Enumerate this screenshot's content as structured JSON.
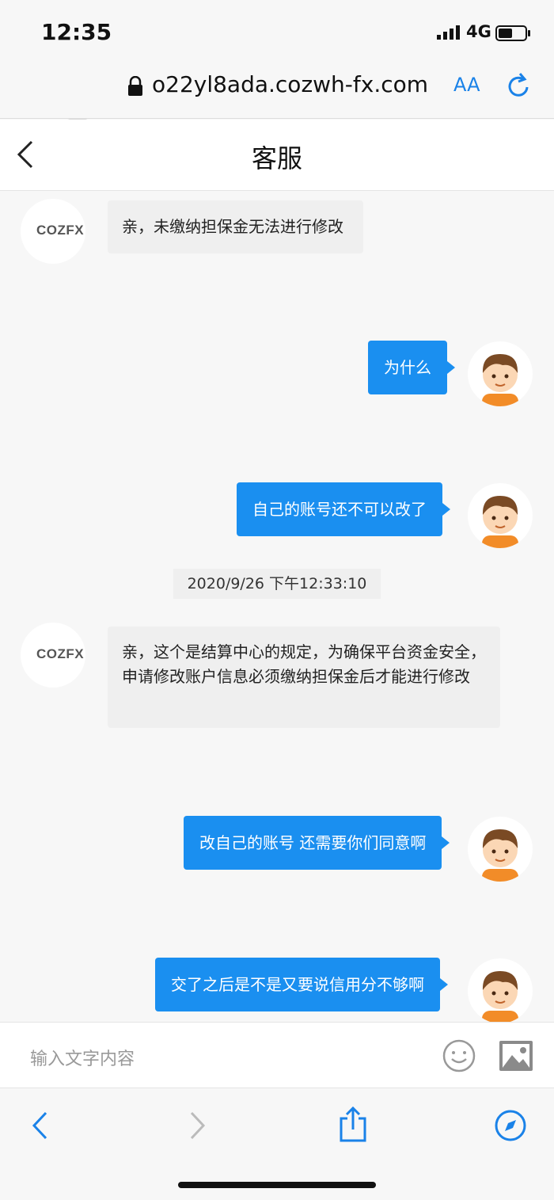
{
  "status_bar": {
    "time": "12:35",
    "network": "4G"
  },
  "url_bar": {
    "url": "o22yl8ada.cozwh-fx.com",
    "text_size_label": "AA"
  },
  "header": {
    "title": "客服"
  },
  "messages": [
    {
      "side": "in",
      "text": "亲，未缴纳担保金无法进行修改"
    },
    {
      "side": "out",
      "text": "为什么"
    },
    {
      "side": "out",
      "text": "自己的账号还不可以改了"
    },
    {
      "side": "in",
      "text": "亲，这个是结算中心的规定，为确保平台资金安全，申请修改账户信息必须缴纳担保金后才能进行修改"
    },
    {
      "side": "out",
      "text": "改自己的账号 还需要你们同意啊"
    },
    {
      "side": "out",
      "text": "交了之后是不是又要说信用分不够啊"
    }
  ],
  "timestamp": "2020/9/26 下午12:33:10",
  "brand": {
    "logo_text": "COZFX",
    "accent": "#e87a1a"
  },
  "input": {
    "placeholder": "输入文字内容"
  },
  "colors": {
    "accent_blue": "#1a8ff0",
    "toolbar_blue": "#1a82e8"
  },
  "icons": [
    "lock-icon",
    "text-size-icon",
    "reload-icon",
    "back-chevron-icon",
    "emoji-icon",
    "image-icon",
    "back-icon",
    "forward-icon",
    "share-icon",
    "compass-icon"
  ]
}
